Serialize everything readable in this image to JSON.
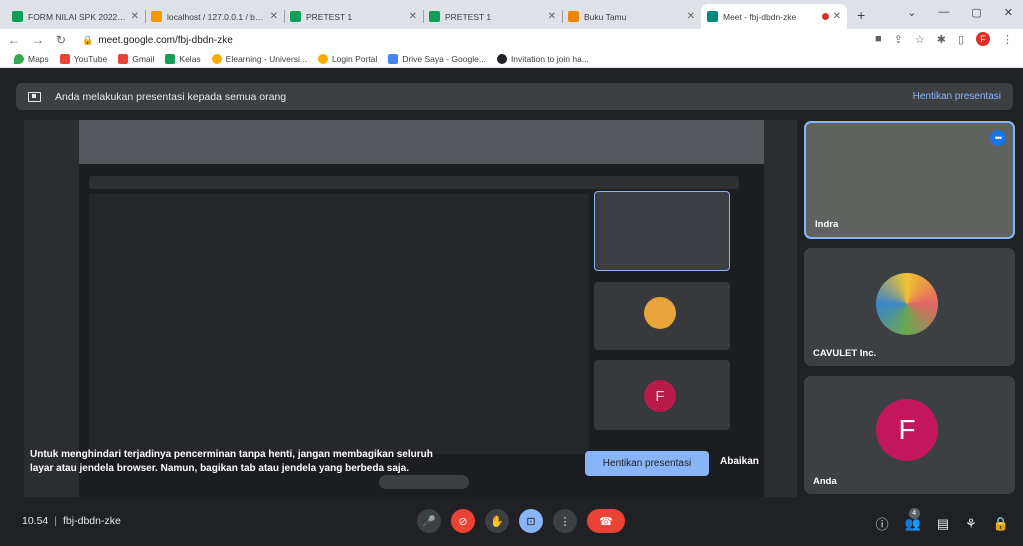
{
  "tabs": [
    {
      "title": "FORM NILAI SPK 2022/202",
      "color": "#0f9d58"
    },
    {
      "title": "localhost / 127.0.0.1 / buku",
      "color": "#f29900"
    },
    {
      "title": "PRETEST 1",
      "color": "#0f9d58"
    },
    {
      "title": "PRETEST 1",
      "color": "#0f9d58"
    },
    {
      "title": "Buku Tamu",
      "color": "#ea8600"
    },
    {
      "title": "Meet - fbj-dbdn-zke",
      "color": "#00897b"
    }
  ],
  "omnibar": {
    "url": "meet.google.com/fbj-dbdn-zke",
    "profile": "F"
  },
  "bookmarks": [
    {
      "label": "Maps",
      "color": "#34a853"
    },
    {
      "label": "YouTube",
      "color": "#ea4335"
    },
    {
      "label": "Gmail",
      "color": "#ea4335"
    },
    {
      "label": "Kelas",
      "color": "#0f9d58"
    },
    {
      "label": "Elearning - Universi...",
      "color": "#f9ab00"
    },
    {
      "label": "Login Portal",
      "color": "#f9ab00"
    },
    {
      "label": "Drive Saya - Google...",
      "color": "#4285f4"
    },
    {
      "label": "Invitation to join ha...",
      "color": "#202124"
    }
  ],
  "banner": {
    "text": "Anda melakukan presentasi kepada semua orang",
    "stop": "Hentikan presentasi"
  },
  "notice": {
    "line1": "Untuk menghindari terjadinya pencerminan tanpa henti, jangan membagikan seluruh",
    "line2": "layar atau jendela browser. Namun, bagikan tab atau jendela yang berbeda saja.",
    "stop": "Hentikan presentasi",
    "ignore": "Abaikan"
  },
  "participants": {
    "indra": "Indra",
    "cavulet": "CAVULET Inc.",
    "anda": "Anda",
    "anda_initial": "F"
  },
  "bottom": {
    "time": "10.54",
    "meeting_code": "fbj-dbdn-zke",
    "participant_count": "4"
  }
}
